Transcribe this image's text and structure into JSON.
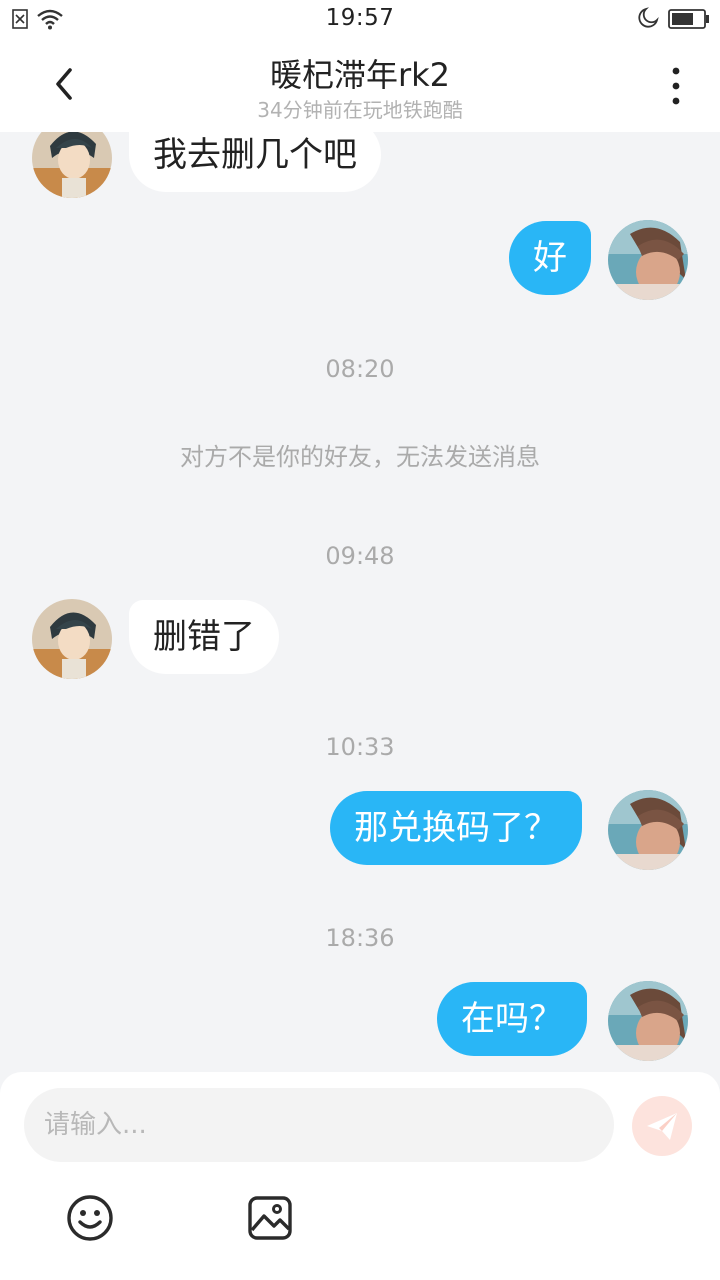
{
  "status_bar": {
    "time": "19:57"
  },
  "header": {
    "title": "暖杞滞年rk2",
    "subtitle": "34分钟前在玩地铁跑酷"
  },
  "messages": [
    {
      "side": "in",
      "text": "我去删几个吧"
    },
    {
      "side": "out",
      "text": "好"
    },
    {
      "type": "time",
      "text": "08:20"
    },
    {
      "type": "system",
      "text": "对方不是你的好友，无法发送消息"
    },
    {
      "type": "time",
      "text": "09:48"
    },
    {
      "side": "in",
      "text": "删错了"
    },
    {
      "type": "time",
      "text": "10:33"
    },
    {
      "side": "out",
      "text": "那兑换码了？"
    },
    {
      "type": "time",
      "text": "18:36"
    },
    {
      "side": "out",
      "text": "在吗？"
    }
  ],
  "composer": {
    "placeholder": "请输入...",
    "value": ""
  },
  "colors": {
    "outgoing_bubble": "#29b6f6",
    "incoming_bubble": "#ffffff",
    "chat_background": "#f3f4f6",
    "send_button": "#fde3dd"
  },
  "icons": {
    "sim": "sim-error-icon",
    "wifi": "wifi-icon",
    "moon": "moon-icon",
    "battery": "battery-icon",
    "back": "chevron-left-icon",
    "more": "more-vertical-icon",
    "send": "paper-plane-icon",
    "emoji": "smiley-icon",
    "image": "image-icon"
  }
}
